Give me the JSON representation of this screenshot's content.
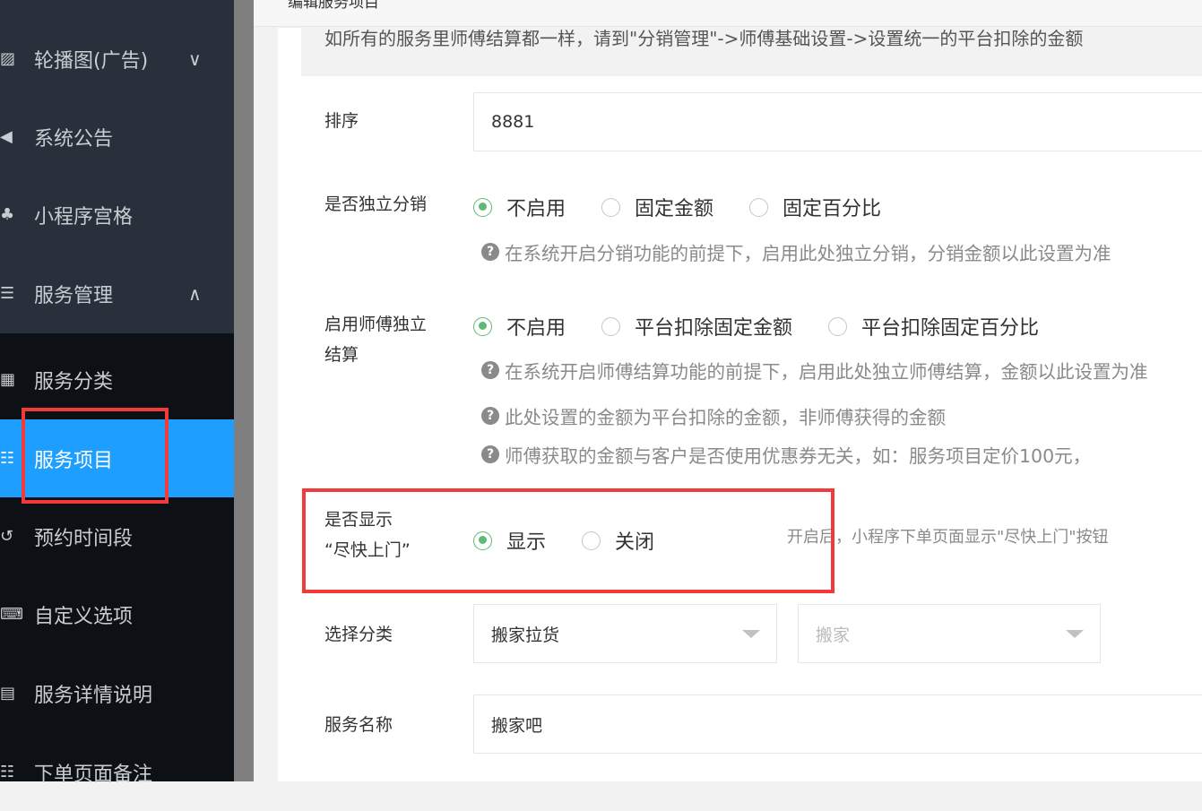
{
  "header": {
    "title": "编辑服务项目"
  },
  "sidebar": {
    "items": [
      {
        "label": "轮播图(广告)",
        "icon": "image-icon",
        "arrow": "∨"
      },
      {
        "label": "系统公告",
        "icon": "volume-icon"
      },
      {
        "label": "小程序宫格",
        "icon": "sitemap-icon"
      },
      {
        "label": "服务管理",
        "icon": "server-icon",
        "arrow": "∧"
      },
      {
        "label": "服务分类",
        "icon": "grid-icon"
      },
      {
        "label": "服务项目",
        "icon": "list-icon",
        "active": true
      },
      {
        "label": "预约时间段",
        "icon": "history-icon"
      },
      {
        "label": "自定义选项",
        "icon": "keyboard-icon"
      },
      {
        "label": "服务详情说明",
        "icon": "file-icon"
      },
      {
        "label": "下单页面备注",
        "icon": "list-icon"
      }
    ]
  },
  "notice": "如所有的服务里师傅结算都一样，请到\"分销管理\"->师傅基础设置->设置统一的平台扣除的金额",
  "form": {
    "sort": {
      "label": "排序",
      "value": "8881"
    },
    "distribution": {
      "label": "是否独立分销",
      "options": [
        "不启用",
        "固定金额",
        "固定百分比"
      ],
      "selected": 0,
      "tip": "在系统开启分销功能的前提下，启用此处独立分销，分销金额以此设置为准"
    },
    "settlement": {
      "label_1": "启用师傅独立",
      "label_2": "结算",
      "options": [
        "不启用",
        "平台扣除固定金额",
        "平台扣除固定百分比"
      ],
      "selected": 0,
      "tips": [
        "在系统开启师傅结算功能的前提下，启用此处独立师傅结算，金额以此设置为准",
        "此处设置的金额为平台扣除的金额，非师傅获得的金额",
        "师傅获取的金额与客户是否使用优惠券无关，如：服务项目定价100元，"
      ]
    },
    "asap": {
      "label_1": "是否显示",
      "label_2": "“尽快上门”",
      "options": [
        "显示",
        "关闭"
      ],
      "selected": 0,
      "hint": "开启后，小程序下单页面显示\"尽快上门\"按钮"
    },
    "category": {
      "label": "选择分类",
      "primary": "搬家拉货",
      "secondary_placeholder": "搬家"
    },
    "name": {
      "label": "服务名称",
      "value": "搬家吧"
    }
  },
  "colors": {
    "accent": "#1e9fff",
    "radio": "#5fb878",
    "highlight": "#f33a3a"
  }
}
